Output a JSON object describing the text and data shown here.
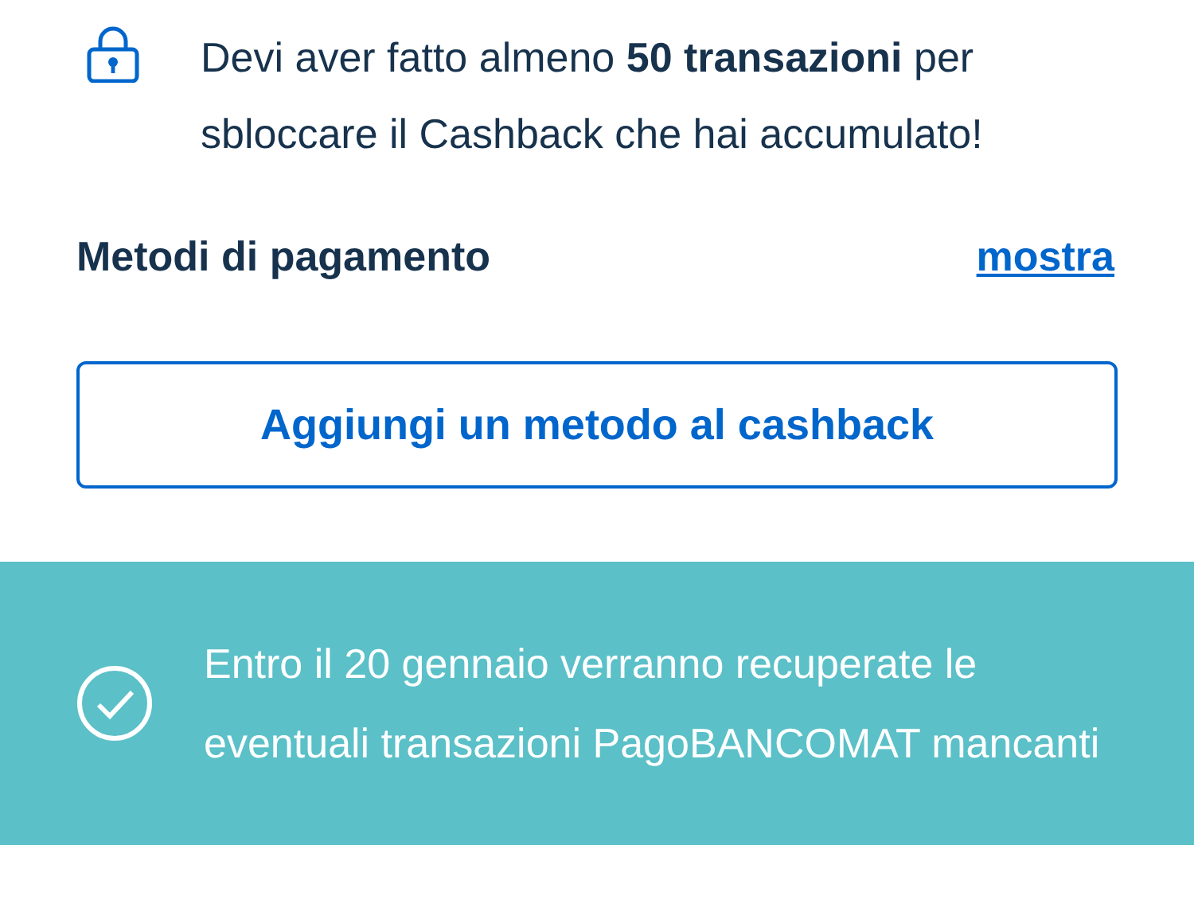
{
  "notice": {
    "text": "Devi aver fatto almeno **50 transazioni** per sbloccare il Cashback che hai accumulato!"
  },
  "payment_methods": {
    "title": "Metodi di pagamento",
    "link": "mostra"
  },
  "add_button": {
    "label": "Aggiungi un metodo al cashback"
  },
  "banner": {
    "text": "Entro il 20 gennaio verranno recuperate le eventuali transazioni PagoBANCOMAT mancanti"
  }
}
